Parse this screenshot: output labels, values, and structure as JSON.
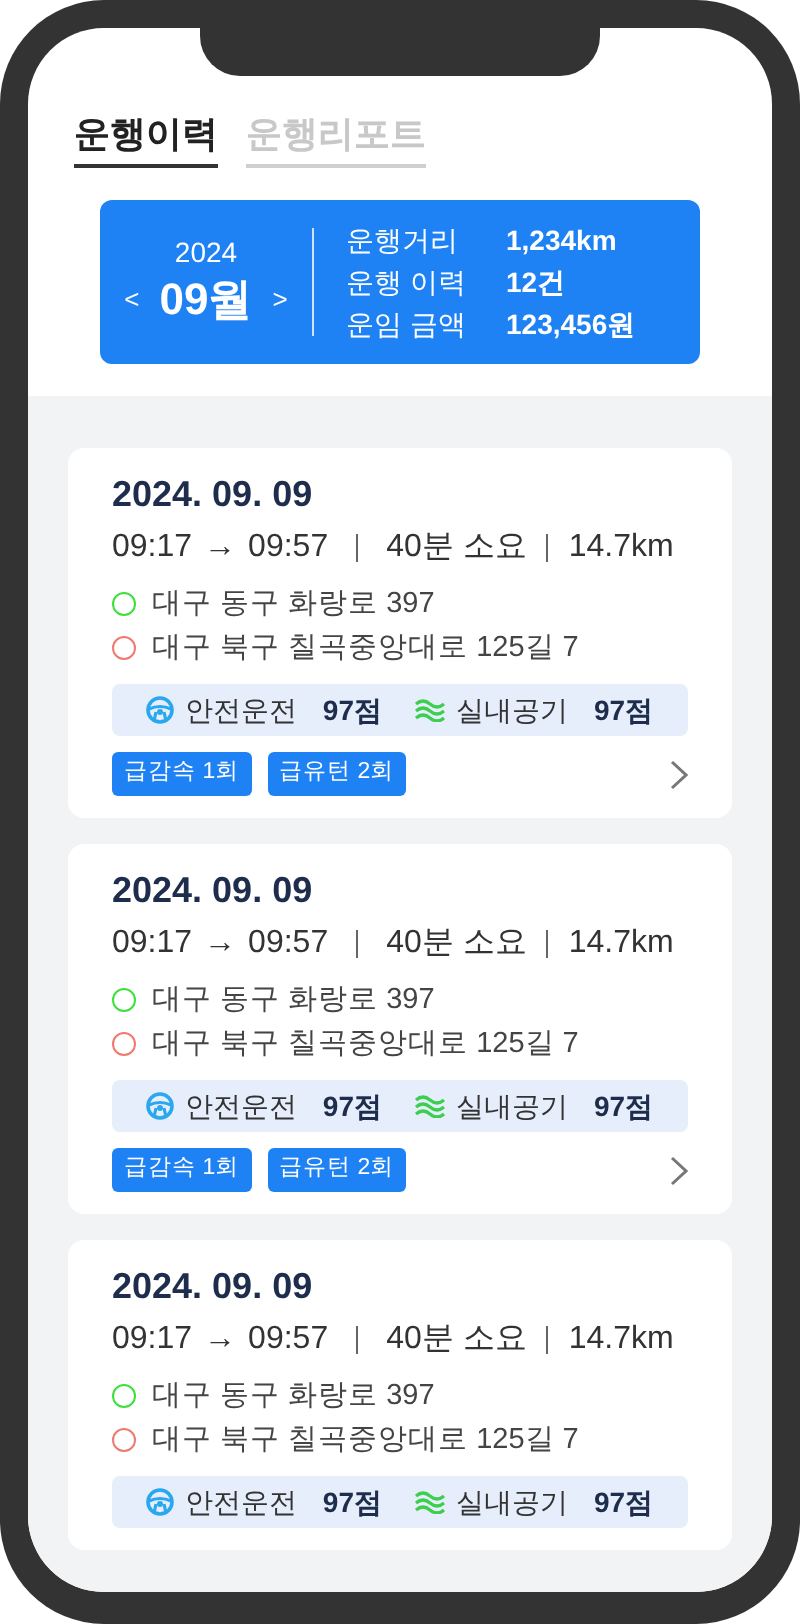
{
  "tabs": [
    {
      "label": "운행이력",
      "selected": true
    },
    {
      "label": "운행리포트",
      "selected": false
    }
  ],
  "summary": {
    "year": "2024",
    "month": "09월",
    "prev": "<",
    "next": ">",
    "stats": [
      {
        "label": "운행거리",
        "value": "1,234km"
      },
      {
        "label": "운행 이력",
        "value": "12건"
      },
      {
        "label": "운임 금액",
        "value": "123,456원"
      }
    ]
  },
  "trips": [
    {
      "date": "2024. 09. 09",
      "start_time": "09:17",
      "arrow": "→",
      "end_time": "09:57",
      "duration": "40분 소요",
      "distance": "14.7km",
      "locations": [
        {
          "text": "대구 동구 화랑로 397",
          "color": "#3ee03e"
        },
        {
          "text": "대구 북구 칠곡중앙대로 125길 7",
          "color": "#f07a6e"
        }
      ],
      "scores": [
        {
          "kind": "driving",
          "label": "안전운전",
          "value": "97점"
        },
        {
          "kind": "air",
          "label": "실내공기",
          "value": "97점"
        }
      ],
      "tags": [
        "급감속 1회",
        "급유턴 2회"
      ],
      "chevron": true
    },
    {
      "date": "2024. 09. 09",
      "start_time": "09:17",
      "arrow": "→",
      "end_time": "09:57",
      "duration": "40분 소요",
      "distance": "14.7km",
      "locations": [
        {
          "text": "대구 동구 화랑로 397",
          "color": "#3ee03e"
        },
        {
          "text": "대구 북구 칠곡중앙대로 125길 7",
          "color": "#f07a6e"
        }
      ],
      "scores": [
        {
          "kind": "driving",
          "label": "안전운전",
          "value": "97점"
        },
        {
          "kind": "air",
          "label": "실내공기",
          "value": "97점"
        }
      ],
      "tags": [
        "급감속 1회",
        "급유턴 2회"
      ],
      "chevron": true
    },
    {
      "date": "2024. 09. 09",
      "start_time": "09:17",
      "arrow": "→",
      "end_time": "09:57",
      "duration": "40분 소요",
      "distance": "14.7km",
      "locations": [
        {
          "text": "대구 동구 화랑로 397",
          "color": "#3ee03e"
        },
        {
          "text": "대구 북구 칠곡중앙대로 125길 7",
          "color": "#f07a6e"
        }
      ],
      "scores": [
        {
          "kind": "driving",
          "label": "안전운전",
          "value": "97점"
        },
        {
          "kind": "air",
          "label": "실내공기",
          "value": "97점"
        }
      ],
      "chevron": false
    }
  ]
}
